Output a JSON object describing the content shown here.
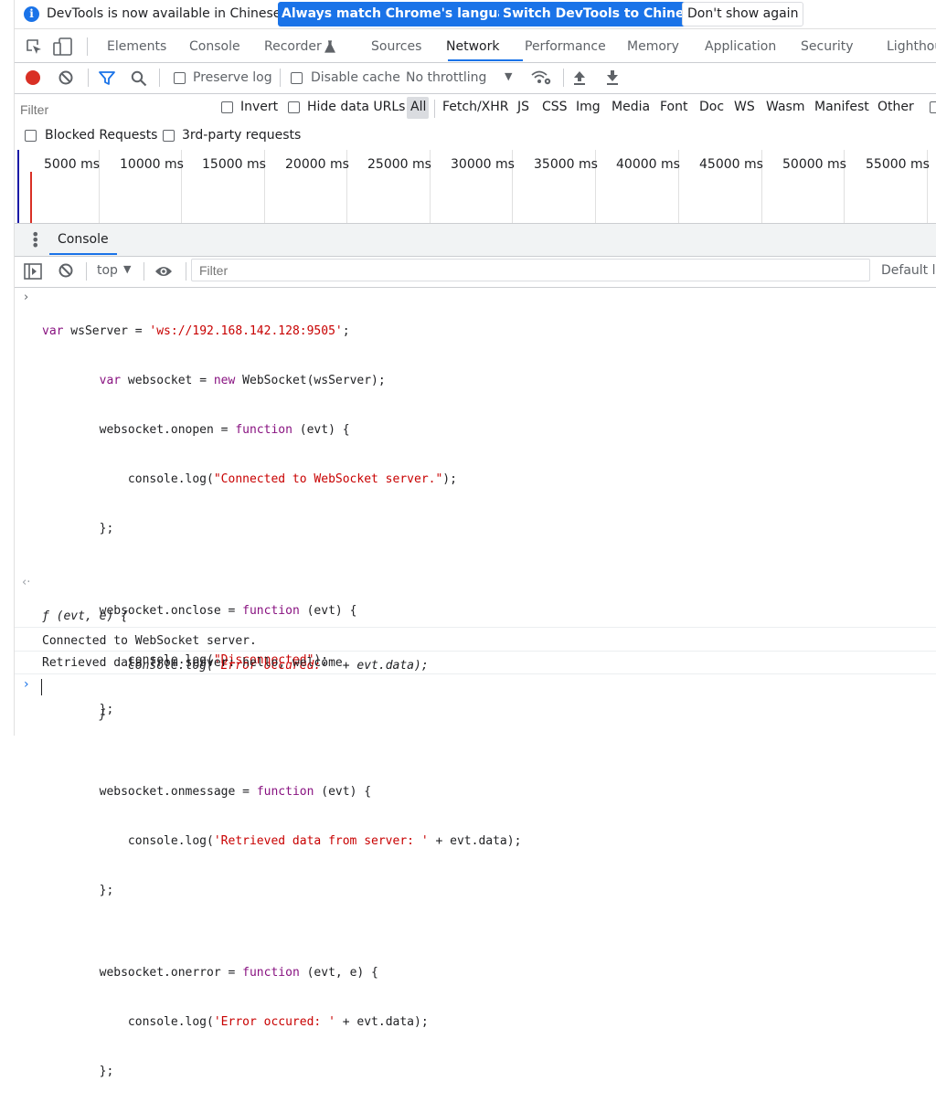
{
  "infobar": {
    "message": "DevTools is now available in Chinese!",
    "match_button": "Always match Chrome's language",
    "switch_button": "Switch DevTools to Chinese",
    "dismiss_button": "Don't show again"
  },
  "tabs": [
    {
      "label": "Elements"
    },
    {
      "label": "Console"
    },
    {
      "label": "Recorder"
    },
    {
      "label": "Sources"
    },
    {
      "label": "Network"
    },
    {
      "label": "Performance"
    },
    {
      "label": "Memory"
    },
    {
      "label": "Application"
    },
    {
      "label": "Security"
    },
    {
      "label": "Lighthou"
    }
  ],
  "active_tab": "Network",
  "network_toolbar": {
    "preserve_log": "Preserve log",
    "disable_cache": "Disable cache",
    "throttling": "No throttling"
  },
  "filter": {
    "placeholder": "Filter",
    "invert": "Invert",
    "hide_data_urls": "Hide data URLs",
    "types": [
      "All",
      "Fetch/XHR",
      "JS",
      "CSS",
      "Img",
      "Media",
      "Font",
      "Doc",
      "WS",
      "Wasm",
      "Manifest",
      "Other"
    ]
  },
  "blocked": {
    "blocked_requests": "Blocked Requests",
    "third_party": "3rd-party requests"
  },
  "timeline_ticks": [
    "5000 ms",
    "10000 ms",
    "15000 ms",
    "20000 ms",
    "25000 ms",
    "30000 ms",
    "35000 ms",
    "40000 ms",
    "45000 ms",
    "50000 ms",
    "55000 ms"
  ],
  "drawer": {
    "tab_label": "Console"
  },
  "console_toolbar": {
    "context": "top",
    "filter_placeholder": "Filter",
    "levels": "Default le"
  },
  "console": {
    "input_lines": [
      "var wsServer = 'ws://192.168.142.128:9505';",
      "        var websocket = new WebSocket(wsServer);",
      "        websocket.onopen = function (evt) {",
      "            console.log(\"Connected to WebSocket server.\");",
      "        };",
      "",
      "        websocket.onclose = function (evt) {",
      "            console.log(\"Disconnected\");",
      "        };",
      "",
      "        websocket.onmessage = function (evt) {",
      "            console.log('Retrieved data from server: ' + evt.data);",
      "        };",
      "",
      "        websocket.onerror = function (evt, e) {",
      "            console.log('Error occured: ' + evt.data);",
      "        };"
    ],
    "result_lines": [
      "ƒ (evt, e) {",
      "            console.log('Error occured: ' + evt.data);",
      "        }"
    ],
    "log_1": "Connected to WebSocket server.",
    "log_2": "Retrieved data from server: hello, welcome"
  },
  "colors": {
    "accent": "#1a73e8",
    "record_red": "#d93025",
    "keyword": "#881280",
    "string": "#c80000"
  }
}
